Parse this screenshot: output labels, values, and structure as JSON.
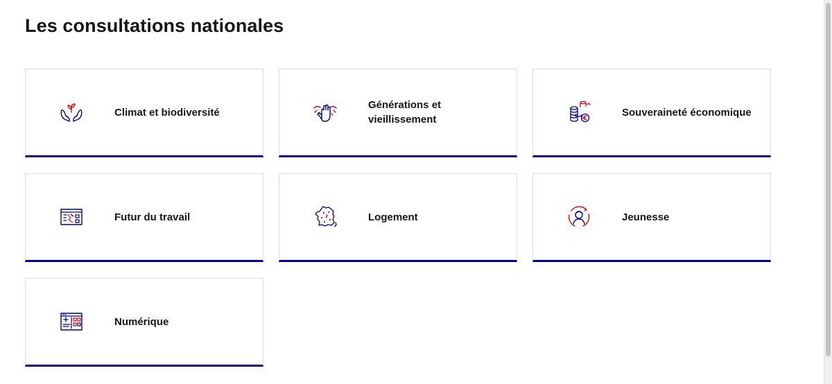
{
  "page": {
    "title": "Les consultations nationales"
  },
  "colors": {
    "accent_blue": "#000091",
    "accent_red": "#e1000f",
    "card_border": "#dddddd",
    "text": "#161616"
  },
  "cards": [
    {
      "label": "Climat et biodiversité",
      "icon": "hands-plant-icon"
    },
    {
      "label": "Générations et vieillissement",
      "icon": "raised-hand-icon"
    },
    {
      "label": "Souveraineté économique",
      "icon": "coins-euro-icon"
    },
    {
      "label": "Futur du travail",
      "icon": "workflow-board-icon"
    },
    {
      "label": "Logement",
      "icon": "france-map-icon"
    },
    {
      "label": "Jeunesse",
      "icon": "young-person-icon"
    },
    {
      "label": "Numérique",
      "icon": "digital-screen-icon"
    }
  ]
}
